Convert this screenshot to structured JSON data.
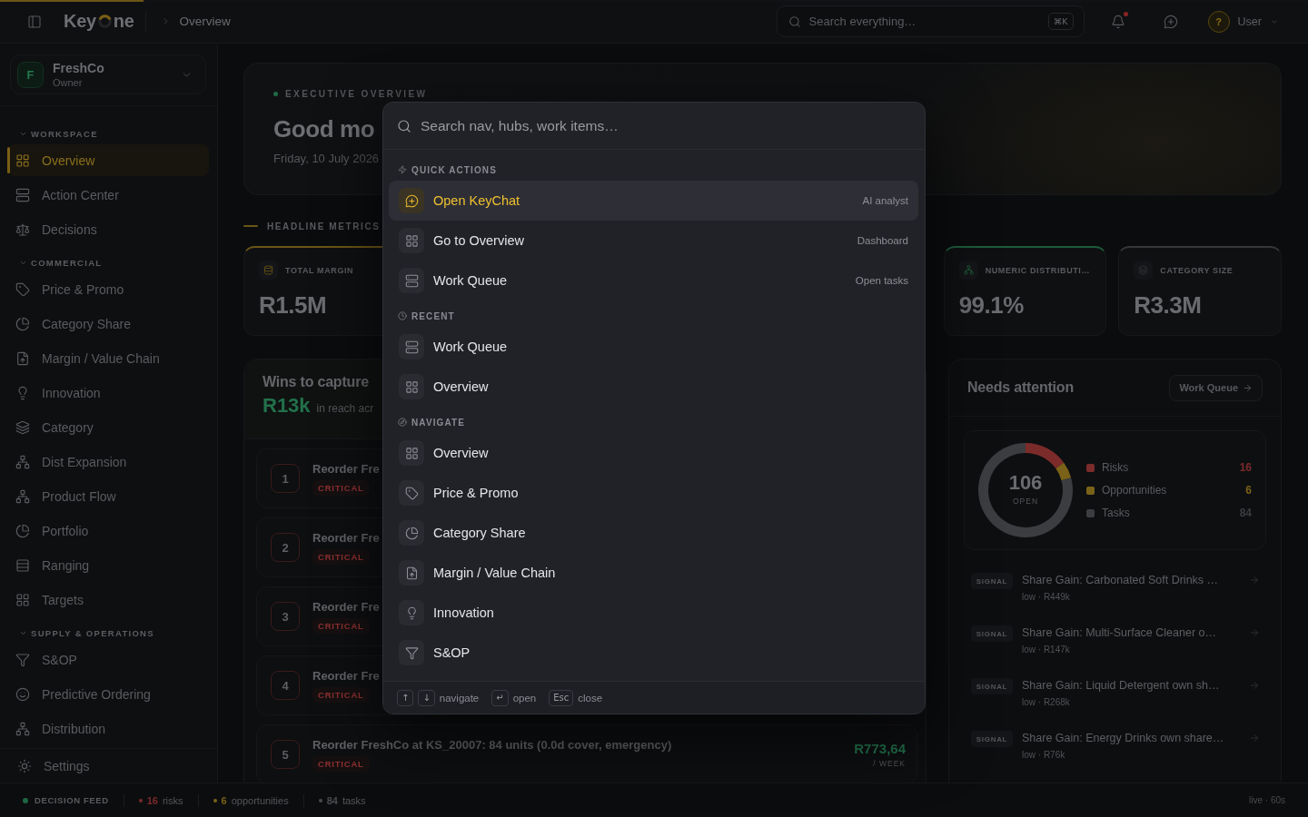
{
  "loading_bar": {
    "level": 0.11
  },
  "topbar": {
    "logo": {
      "left": "Key",
      "right": "ne"
    },
    "breadcrumb": "Overview",
    "search": {
      "placeholder": "Search everything…",
      "shortcut": "⌘K"
    },
    "notifications": {
      "unread": true
    },
    "user": {
      "avatar": "?",
      "name": "User"
    }
  },
  "sidebar": {
    "org": {
      "initial": "F",
      "name": "FreshCo",
      "role": "Owner"
    },
    "sections": [
      {
        "title": "WORKSPACE",
        "expanded": true,
        "items": [
          {
            "label": "Overview",
            "selected": true
          },
          {
            "label": "Action Center",
            "selected": false
          },
          {
            "label": "Decisions",
            "selected": false
          }
        ]
      },
      {
        "title": "COMMERCIAL",
        "expanded": true,
        "items": [
          {
            "label": "Price & Promo",
            "selected": false
          },
          {
            "label": "Category Share",
            "selected": false
          },
          {
            "label": "Margin / Value Chain",
            "selected": false
          },
          {
            "label": "Innovation",
            "selected": false
          },
          {
            "label": "Category",
            "selected": false
          },
          {
            "label": "Dist Expansion",
            "selected": false
          },
          {
            "label": "Product Flow",
            "selected": false
          },
          {
            "label": "Portfolio",
            "selected": false
          },
          {
            "label": "Ranging",
            "selected": false
          },
          {
            "label": "Targets",
            "selected": false
          }
        ]
      },
      {
        "title": "SUPPLY & OPERATIONS",
        "expanded": true,
        "items": [
          {
            "label": "S&OP",
            "selected": false
          },
          {
            "label": "Predictive Ordering",
            "selected": false
          },
          {
            "label": "Distribution",
            "selected": false
          }
        ]
      }
    ],
    "footer": {
      "label": "Settings"
    }
  },
  "hero": {
    "eyebrow": "EXECUTIVE OVERVIEW",
    "greeting": "Good mo",
    "date": "Friday, 10 July 2026"
  },
  "headline_metrics": {
    "title": "HEADLINE METRICS",
    "cards": [
      {
        "label": "TOTAL MARGIN",
        "value": "R1.5M",
        "color": "#6b5516"
      },
      {
        "label": "NUMERIC DISTRIBUTI…",
        "value": "99.1%",
        "color": "#1d5c3b"
      },
      {
        "label": "CATEGORY SIZE",
        "value": "R3.3M",
        "color": "#36373b"
      }
    ]
  },
  "wins": {
    "title": "Wins to capture",
    "amount": "R13k",
    "caption": "in reach acr",
    "rows": [
      {
        "rank": "1",
        "title": "Reorder Fre",
        "priority": "CRITICAL"
      },
      {
        "rank": "2",
        "title": "Reorder Fre",
        "priority": "CRITICAL"
      },
      {
        "rank": "3",
        "title": "Reorder Fre",
        "priority": "CRITICAL"
      },
      {
        "rank": "4",
        "title": "Reorder Fre",
        "priority": "CRITICAL"
      },
      {
        "rank": "5",
        "title": "Reorder FreshCo at KS_20007: 84 units (0.0d cover, emergency)",
        "priority": "CRITICAL",
        "value": "R773,64",
        "unit": "/ WEEK"
      }
    ]
  },
  "needs_attention": {
    "title": "Needs attention",
    "action": "Work Queue",
    "summary": {
      "total": "106",
      "caption": "OPEN",
      "slices": [
        {
          "color": "#7c2b2b"
        },
        {
          "color": "#7a6318"
        },
        {
          "color": "#3c3d41"
        }
      ],
      "chart_data": {
        "type": "donut",
        "categories": [
          "Risks",
          "Opportunities",
          "Tasks"
        ],
        "values": [
          16,
          6,
          84
        ],
        "value_labels": [
          "16",
          "6",
          "84"
        ],
        "legend": "right"
      }
    },
    "signals": [
      {
        "tag": "SIGNAL",
        "title": "Share Gain: Carbonated Soft Drinks …",
        "meta": "low · R449k"
      },
      {
        "tag": "SIGNAL",
        "title": "Share Gain: Multi-Surface Cleaner o…",
        "meta": "low · R147k"
      },
      {
        "tag": "SIGNAL",
        "title": "Share Gain: Liquid Detergent own sh…",
        "meta": "low · R268k"
      },
      {
        "tag": "SIGNAL",
        "title": "Share Gain: Energy Drinks own share…",
        "meta": "low · R76k"
      }
    ]
  },
  "status_bar": {
    "feed": {
      "label": "DECISION FEED",
      "color": "#1d6641"
    },
    "counts": [
      {
        "value": "16",
        "label": "risks",
        "color": "#7a2a2a"
      },
      {
        "value": "6",
        "label": "opportunities",
        "color": "#7a6318"
      },
      {
        "value": "84",
        "label": "tasks",
        "color": "#4a4b4f"
      }
    ],
    "refresh": "live · 60s"
  },
  "command_palette": {
    "search": {
      "placeholder": "Search nav, hubs, work items…"
    },
    "groups": [
      {
        "title": "QUICK ACTIONS",
        "items": [
          {
            "label": "Open KeyChat",
            "hint": "AI analyst",
            "selected": true
          },
          {
            "label": "Go to Overview",
            "hint": "Dashboard",
            "selected": false
          },
          {
            "label": "Work Queue",
            "hint": "Open tasks",
            "selected": false
          }
        ]
      },
      {
        "title": "RECENT",
        "items": [
          {
            "label": "Work Queue",
            "selected": false
          },
          {
            "label": "Overview",
            "selected": false
          }
        ]
      },
      {
        "title": "NAVIGATE",
        "items": [
          {
            "label": "Overview",
            "selected": false
          },
          {
            "label": "Price & Promo",
            "selected": false
          },
          {
            "label": "Category Share",
            "selected": false
          },
          {
            "label": "Margin / Value Chain",
            "selected": false
          },
          {
            "label": "Innovation",
            "selected": false
          },
          {
            "label": "S&OP",
            "selected": false
          }
        ]
      }
    ],
    "shortcuts": [
      {
        "keys": [
          "↑",
          "↓"
        ],
        "label": "navigate"
      },
      {
        "keys": [
          "↵"
        ],
        "label": "open"
      },
      {
        "keys": [
          "Esc"
        ],
        "label": "close"
      }
    ]
  }
}
